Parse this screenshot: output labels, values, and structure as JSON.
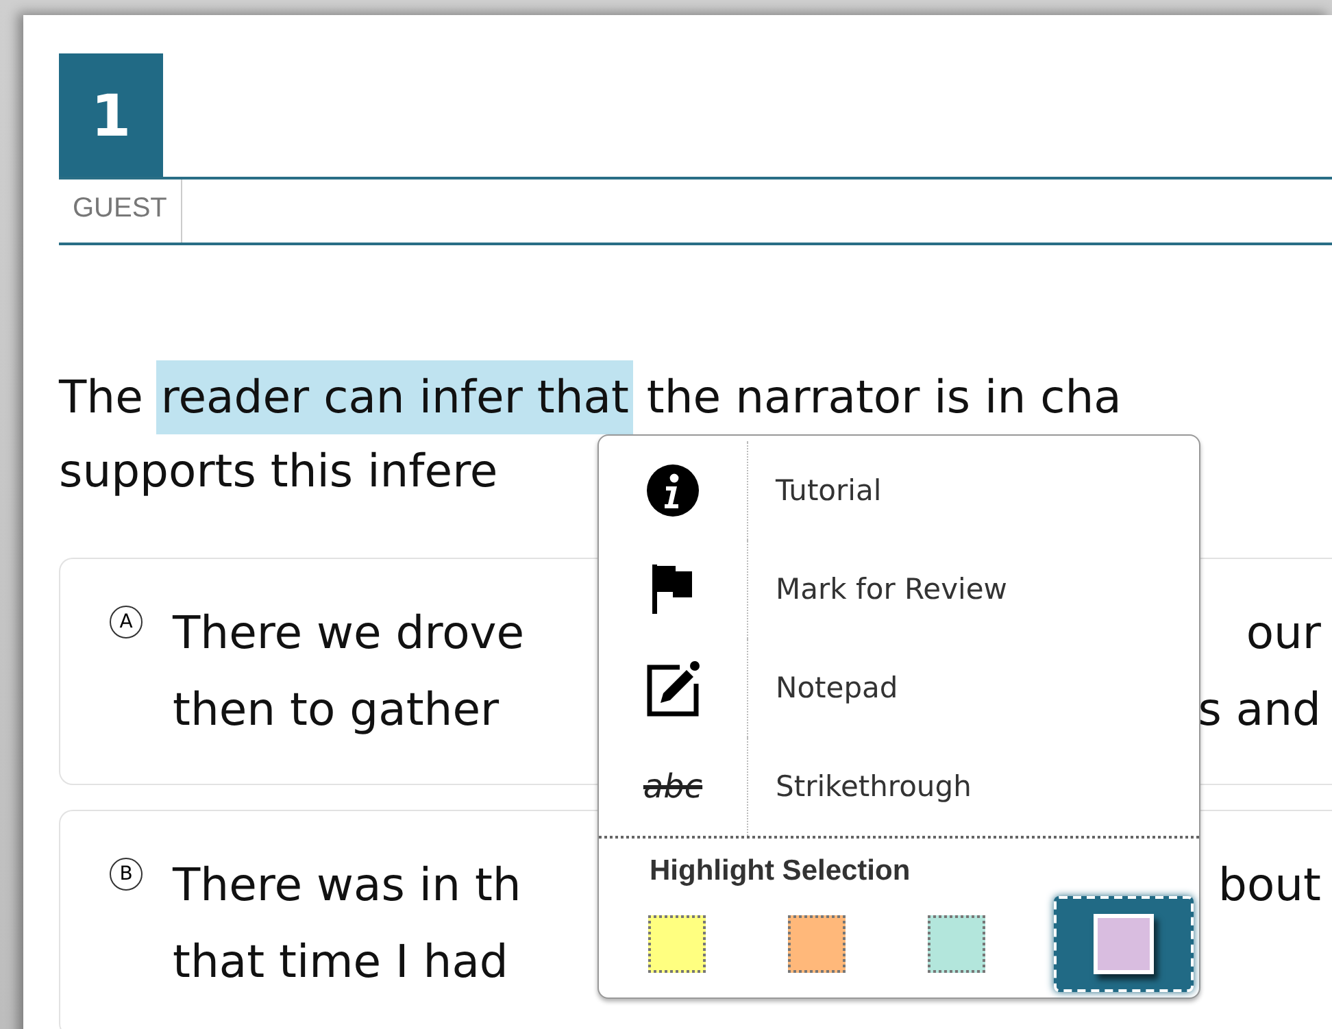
{
  "question_number": "1",
  "user_label": "GUEST",
  "question": {
    "lines": [
      [
        {
          "text": "The",
          "highlighted": false
        },
        {
          "text": "reader can infer that",
          "highlighted": true
        },
        {
          "text": "the narrator is in cha",
          "highlighted": false
        }
      ],
      [
        {
          "text": "supports this infere",
          "highlighted": false
        }
      ]
    ]
  },
  "options": [
    {
      "letter": "A",
      "lines": [
        {
          "left": "There we drove",
          "right": "our"
        },
        {
          "left": "then to gather",
          "right": "s and"
        }
      ]
    },
    {
      "letter": "B",
      "lines": [
        {
          "left": "There was in th",
          "right": "bout"
        },
        {
          "left": "that time I had"
        }
      ]
    }
  ],
  "context_menu": {
    "items": [
      {
        "kind": "info",
        "label": "Tutorial"
      },
      {
        "kind": "flag",
        "label": "Mark for Review"
      },
      {
        "kind": "notepad",
        "label": "Notepad"
      },
      {
        "kind": "strike",
        "label": "Strikethrough",
        "icon_text": "abc"
      }
    ],
    "highlight": {
      "title": "Highlight Selection",
      "swatches": [
        {
          "color": "#ffff80",
          "selected": false
        },
        {
          "color": "#ffb87a",
          "selected": false
        },
        {
          "color": "#b3e6dc",
          "selected": false
        },
        {
          "color": "#d9bde0",
          "selected": true
        }
      ]
    }
  }
}
